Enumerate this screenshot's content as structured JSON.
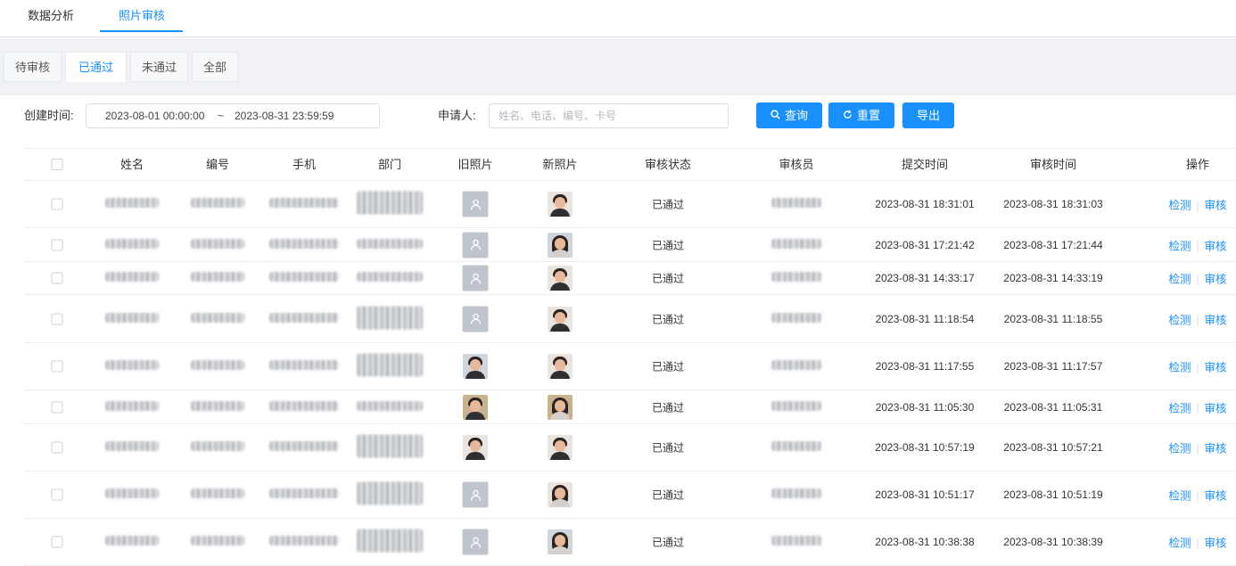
{
  "top_tabs": [
    "数据分析",
    "照片审核"
  ],
  "sub_tabs": [
    "待审核",
    "已通过",
    "未通过",
    "全部"
  ],
  "filters": {
    "created_label": "创建时间:",
    "start": "2023-08-01 00:00:00",
    "range_sep": "~",
    "end": "2023-08-31 23:59:59",
    "applicant_label": "申请人:",
    "applicant_placeholder": "姓名、电话、编号、卡号"
  },
  "buttons": {
    "search": "查询",
    "reset": "重置",
    "export": "导出"
  },
  "colors": {
    "primary": "#1890ff",
    "placeholder_avatar": "#c0c4cc"
  },
  "columns": [
    "姓名",
    "编号",
    "手机",
    "部门",
    "旧照片",
    "新照片",
    "审核状态",
    "审核员",
    "提交时间",
    "审核时间",
    "操作"
  ],
  "actions": {
    "detect": "检测",
    "review": "审核"
  },
  "rows": [
    {
      "old_photo": "placeholder",
      "status": "已通过",
      "submitted": "2023-08-31 18:31:01",
      "reviewed": "2023-08-31 18:31:03"
    },
    {
      "old_photo": "placeholder",
      "status": "已通过",
      "submitted": "2023-08-31 17:21:42",
      "reviewed": "2023-08-31 17:21:44"
    },
    {
      "old_photo": "placeholder",
      "status": "已通过",
      "submitted": "2023-08-31 14:33:17",
      "reviewed": "2023-08-31 14:33:19"
    },
    {
      "old_photo": "placeholder",
      "status": "已通过",
      "submitted": "2023-08-31 11:18:54",
      "reviewed": "2023-08-31 11:18:55"
    },
    {
      "old_photo": "photo",
      "status": "已通过",
      "submitted": "2023-08-31 11:17:55",
      "reviewed": "2023-08-31 11:17:57"
    },
    {
      "old_photo": "photo",
      "status": "已通过",
      "submitted": "2023-08-31 11:05:30",
      "reviewed": "2023-08-31 11:05:31"
    },
    {
      "old_photo": "photo",
      "status": "已通过",
      "submitted": "2023-08-31 10:57:19",
      "reviewed": "2023-08-31 10:57:21"
    },
    {
      "old_photo": "placeholder",
      "status": "已通过",
      "submitted": "2023-08-31 10:51:17",
      "reviewed": "2023-08-31 10:51:19"
    },
    {
      "old_photo": "placeholder",
      "status": "已通过",
      "submitted": "2023-08-31 10:38:38",
      "reviewed": "2023-08-31 10:38:39"
    }
  ]
}
